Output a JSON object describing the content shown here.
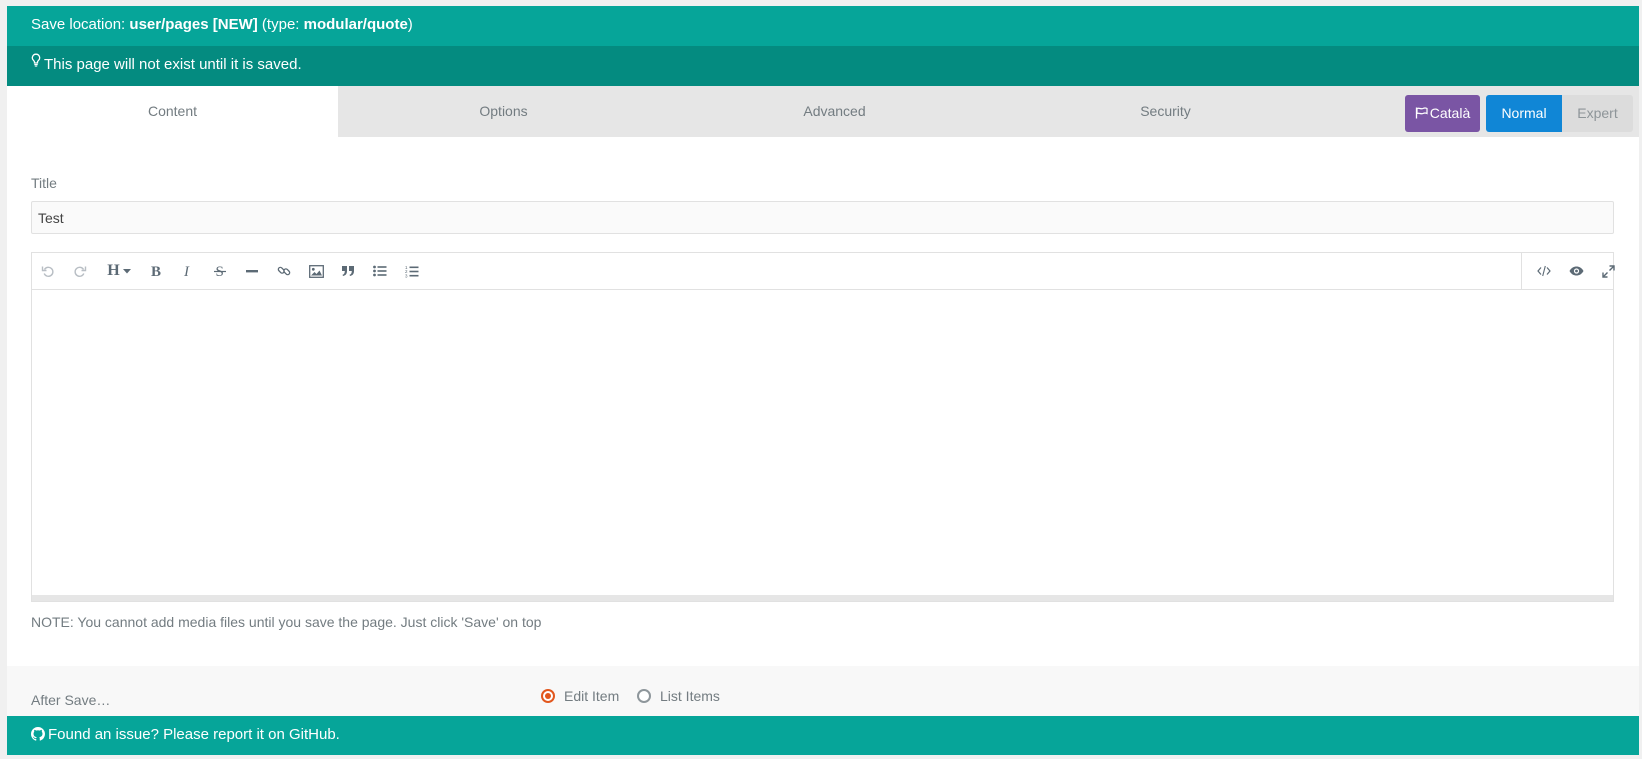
{
  "save_bar": {
    "prefix": "Save location: ",
    "location": "user/pages [NEW]",
    "type_prefix": " (type: ",
    "type": "modular/quote",
    "suffix": ")"
  },
  "notice": {
    "icon": "lightbulb-icon",
    "text": "This page will not exist until it is saved."
  },
  "tabs": [
    {
      "label": "Content",
      "active": true
    },
    {
      "label": "Options",
      "active": false
    },
    {
      "label": "Advanced",
      "active": false
    },
    {
      "label": "Security",
      "active": false
    }
  ],
  "language_button": {
    "icon": "flag-icon",
    "label": "Català",
    "color": "#7a55a4"
  },
  "mode": {
    "normal_label": "Normal",
    "expert_label": "Expert",
    "selected": "Normal"
  },
  "title_field": {
    "label": "Title",
    "value": "Test"
  },
  "editor": {
    "toolbar_left": [
      "undo-icon",
      "redo-icon",
      "heading-icon",
      "bold-icon",
      "italic-icon",
      "strikethrough-icon",
      "horizontal-rule-icon",
      "link-icon",
      "image-icon",
      "quote-icon",
      "bullet-list-icon",
      "numbered-list-icon"
    ],
    "toolbar_right": [
      "code-view-icon",
      "preview-icon",
      "fullscreen-icon"
    ],
    "heading_glyph": "H",
    "content": ""
  },
  "note": "NOTE: You cannot add media files until you save the page. Just click 'Save' on top",
  "after_save": {
    "label": "After Save…",
    "options": [
      {
        "label": "Edit Item",
        "checked": true
      },
      {
        "label": "List Items",
        "checked": false
      }
    ]
  },
  "footer": {
    "icon": "github-icon",
    "text": "Found an issue? Please report it on GitHub."
  },
  "colors": {
    "teal": "#06a599",
    "teal_dark": "#048b80",
    "purple": "#7a55a4",
    "blue": "#1086d6",
    "radio_accent": "#e2571e"
  }
}
